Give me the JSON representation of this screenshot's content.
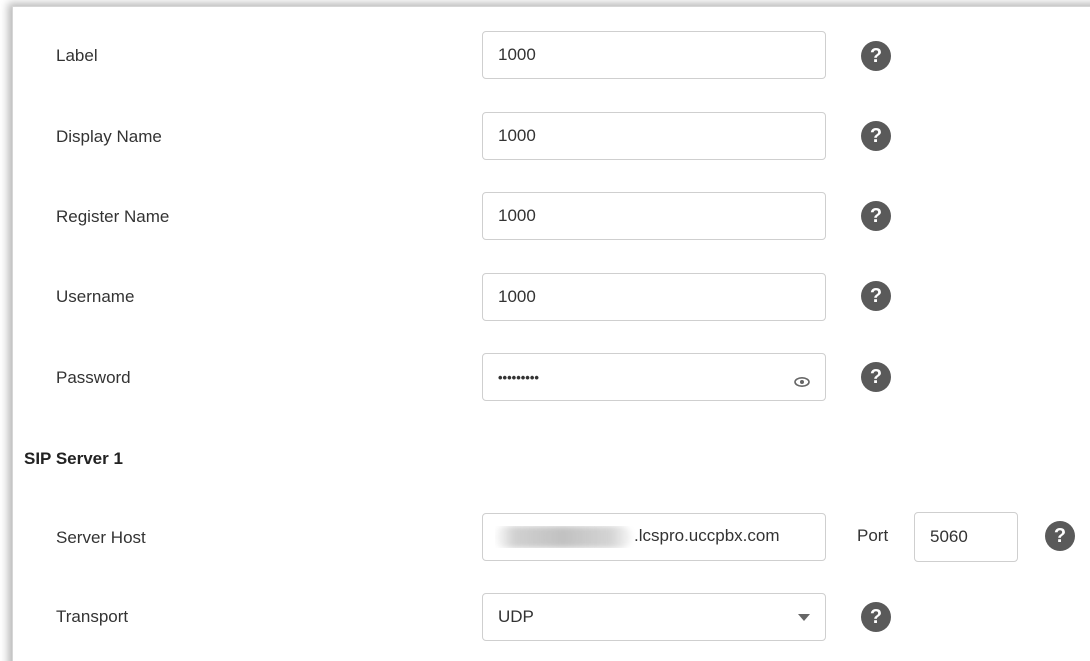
{
  "fields": {
    "label": {
      "label": "Label",
      "value": "1000"
    },
    "display_name": {
      "label": "Display Name",
      "value": "1000"
    },
    "register_name": {
      "label": "Register Name",
      "value": "1000"
    },
    "username": {
      "label": "Username",
      "value": "1000"
    },
    "password": {
      "label": "Password",
      "value": "•••••••••"
    }
  },
  "sip_server": {
    "title": "SIP Server 1",
    "server_host_label": "Server Host",
    "server_host_value": ".lcspro.uccpbx.com",
    "port_label": "Port",
    "port_value": "5060",
    "transport_label": "Transport",
    "transport_value": "UDP"
  },
  "help_glyph": "?",
  "icons": [
    "help-icon",
    "eye-icon",
    "chevron-down-icon"
  ],
  "colors": {
    "help_bg": "#5a5a5a",
    "border": "#cfcfcf",
    "text": "#333333"
  }
}
